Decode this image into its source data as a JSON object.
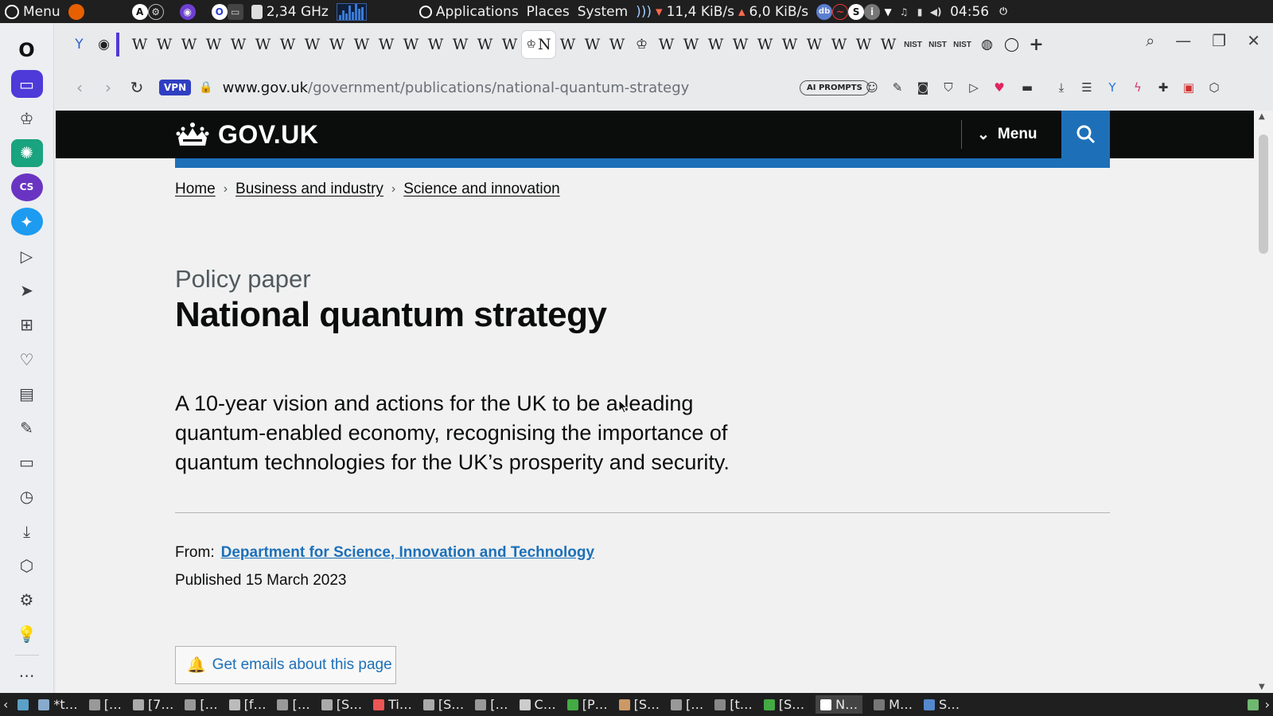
{
  "os_panel": {
    "menu_label": "Menu",
    "cpu_freq": "2,34 GHz",
    "applications_label": "Applications",
    "places_label": "Places",
    "system_label": "System",
    "net_down": "11,4 KiB/s",
    "net_up": "6,0 KiB/s",
    "clock": "04:56"
  },
  "browser": {
    "tabs": [
      {
        "label": "W",
        "kind": "wiki"
      },
      {
        "label": "W",
        "kind": "wiki"
      },
      {
        "label": "W",
        "kind": "wiki"
      },
      {
        "label": "W",
        "kind": "wiki"
      },
      {
        "label": "W",
        "kind": "wiki"
      },
      {
        "label": "W",
        "kind": "wiki"
      },
      {
        "label": "W",
        "kind": "wiki"
      },
      {
        "label": "W",
        "kind": "wiki"
      },
      {
        "label": "W",
        "kind": "wiki"
      },
      {
        "label": "W",
        "kind": "wiki"
      },
      {
        "label": "W",
        "kind": "wiki"
      },
      {
        "label": "W",
        "kind": "wiki"
      },
      {
        "label": "W",
        "kind": "wiki"
      },
      {
        "label": "W",
        "kind": "wiki"
      },
      {
        "label": "W",
        "kind": "wiki"
      },
      {
        "label": "W",
        "kind": "wiki"
      }
    ],
    "active_tab_label": "N",
    "tabs_after": [
      "W",
      "W",
      "W"
    ],
    "tabs_after2": [
      "W",
      "W",
      "W",
      "W",
      "W",
      "W",
      "W",
      "W",
      "W",
      "W"
    ],
    "nist_tabs": [
      "NIST",
      "NIST",
      "NIST"
    ],
    "vpn_label": "VPN",
    "url_host": "www.gov.uk",
    "url_path": "/government/publications/national-quantum-strategy",
    "ai_prompts_label": "AI PROMPTS"
  },
  "page": {
    "logo_text": "GOV.UK",
    "menu_label": "Menu",
    "breadcrumbs": [
      "Home",
      "Business and industry",
      "Science and innovation"
    ],
    "doc_type": "Policy paper",
    "title": "National quantum strategy",
    "summary": "A 10-year vision and actions for the UK to be a leading quantum-enabled economy, recognising the importance of quantum technologies for the UK’s prosperity and security.",
    "from_label": "From:",
    "from_org": "Department for Science, Innovation and Technology",
    "published": "Published 15 March 2023",
    "emails_button": "Get emails about this page"
  },
  "colors": {
    "govuk_black": "#0b0c0c",
    "govuk_blue": "#1d70b8",
    "opera_accent": "#4d3ad9"
  },
  "taskbar": {
    "items": [
      "*t…",
      "[…",
      "[7…",
      "[…",
      "[f…",
      "[…",
      "[S…",
      "Ti…",
      "[S…",
      "[…",
      "C…",
      "[P…",
      "[S…",
      "[…",
      "[t…",
      "[S…",
      "N…",
      "M…",
      "S…"
    ]
  }
}
